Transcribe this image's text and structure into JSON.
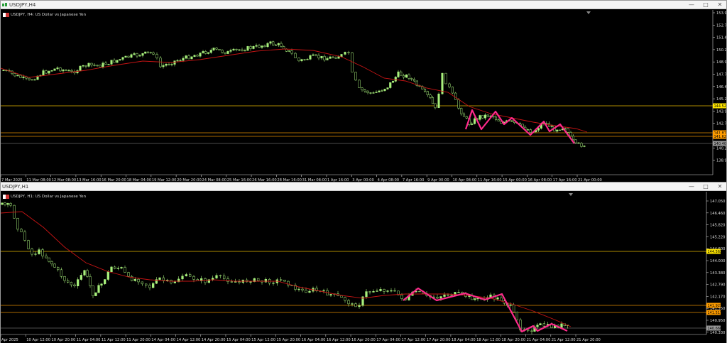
{
  "window_top": {
    "title": "USDJPY,H4",
    "legend": "USDJPY, H4:  US Dollar vs Japanese Yen",
    "price_levels": [
      "153.99",
      "152.73",
      "151.48",
      "150.23",
      "148.98",
      "147.73",
      "146.48",
      "145.23",
      "143.98",
      "142.73",
      "141.48",
      "140.23",
      "138.98"
    ],
    "date_labels": [
      "7 Mar 2025",
      "11 Mar 08:00",
      "12 Mar 08:00",
      "13 Mar 16:00",
      "16 Mar 20:00",
      "18 Mar 04:00",
      "19 Mar 12:00",
      "20 Mar 20:00",
      "24 Mar 08:00",
      "25 Mar 16:00",
      "26 Mar 16:00",
      "28 Mar 16:00",
      "31 Mar 08:00",
      "1 Apr 16:00",
      "3 Apr 00:00",
      "4 Apr 08:00",
      "7 Apr 16:00",
      "9 Apr 00:00",
      "10 Apr 08:00",
      "11 Apr 16:00",
      "15 Apr 00:00",
      "16 Apr 08:00",
      "17 Apr 16:00",
      "21 Apr 00:00"
    ],
    "tags": {
      "yellow": "144.52",
      "orange1": "141.87",
      "orange2": "141.62",
      "grey": "140.40"
    }
  },
  "window_bottom": {
    "title": "USDJPY,H1",
    "legend": "USDJPY, H1:  US Dollar vs Japanese Yen",
    "price_levels": [
      "147.050",
      "146.460",
      "145.820",
      "145.220",
      "144.600",
      "144.000",
      "143.380",
      "142.790",
      "142.170",
      "141.550",
      "140.950",
      "140.330"
    ],
    "date_labels": [
      "Apr 2025",
      "10 Apr 12:00",
      "10 Apr 20:00",
      "11 Apr 04:00",
      "11 Apr 12:00",
      "11 Apr 20:00",
      "14 Apr 04:00",
      "14 Apr 12:00",
      "14 Apr 20:00",
      "15 Apr 04:00",
      "15 Apr 12:00",
      "15 Apr 20:00",
      "16 Apr 04:00",
      "16 Apr 12:00",
      "16 Apr 20:00",
      "17 Apr 04:00",
      "17 Apr 12:00",
      "17 Apr 20:00",
      "18 Apr 04:00",
      "18 Apr 12:00",
      "18 Apr 20:00",
      "21 Apr 04:00",
      "21 Apr 12:00",
      "21 Apr 20:00"
    ],
    "tags": {
      "yellow": "144.563",
      "orange1": "141.923",
      "orange2": "141.517",
      "grey": "140.660"
    }
  },
  "colors": {
    "bull": "#a8f07c",
    "ma": "#c41414",
    "zigzag": "#ff2a8c",
    "yellow_line": "#e6b800",
    "orange_line": "#e08a00",
    "grey_line": "#9a9a9a"
  }
}
